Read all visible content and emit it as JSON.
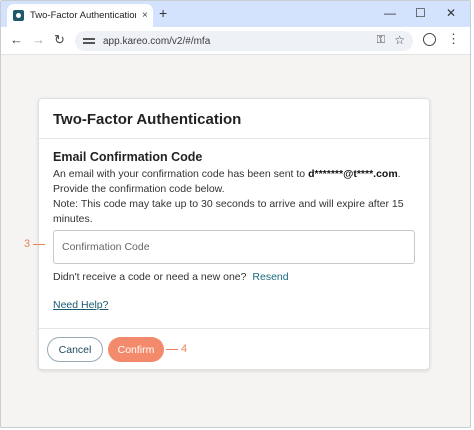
{
  "browser": {
    "tab_title": "Two-Factor Authentication | Tebra",
    "tab_close": "×",
    "new_tab": "+",
    "window_minimize": "—",
    "window_maximize": "☐",
    "window_close": "✕",
    "back": "←",
    "forward": "→",
    "reload": "↻",
    "url": "app.kareo.com/v2/#/mfa",
    "key_glyph": "⚿",
    "star_glyph": "☆",
    "menu_glyph": "⋮"
  },
  "card": {
    "title": "Two-Factor Authentication",
    "section_title": "Email Confirmation Code",
    "desc_pre": "An email with your confirmation code has been sent to ",
    "email_masked": "d*******@t****.com",
    "desc_post": ". Provide the confirmation code below.",
    "note": "Note: This code may take up to 30 seconds to arrive and will expire after 15 minutes.",
    "input_placeholder": "Confirmation Code",
    "input_value": "",
    "resend_prompt": "Didn't receive a code or need a new one?",
    "resend_link": "Resend",
    "help_link": "Need Help?",
    "cancel_label": "Cancel",
    "confirm_label": "Confirm"
  },
  "callouts": {
    "input_number": "3",
    "confirm_number": "4"
  },
  "colors": {
    "confirm_button": "#f38a6c",
    "callout": "#e8825f",
    "link": "#1a6a80",
    "tabbar": "#d3e3fd"
  }
}
